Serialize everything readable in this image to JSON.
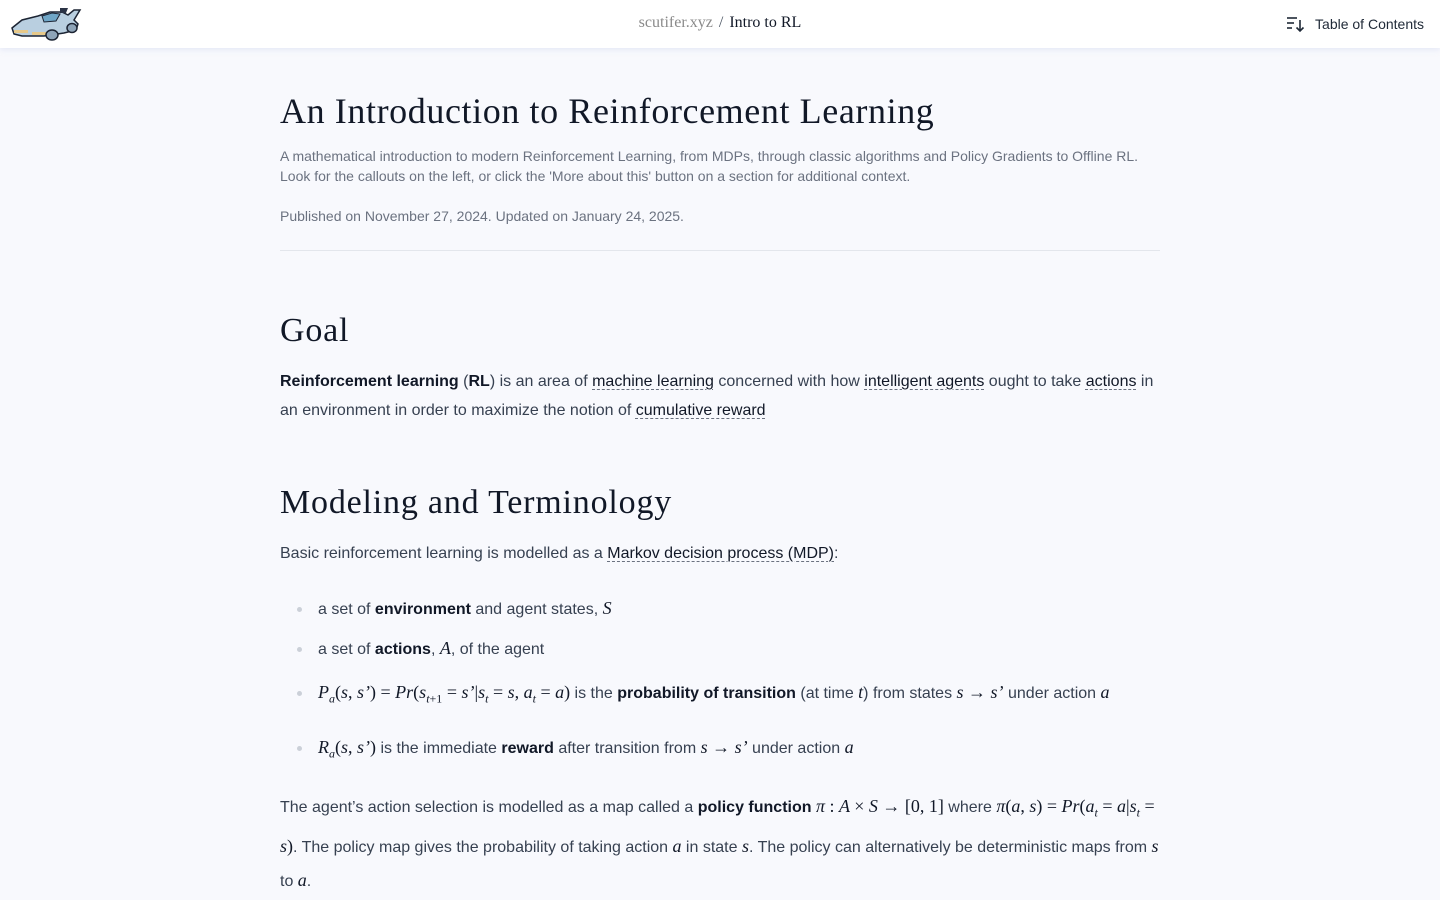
{
  "header": {
    "logo_alt": "hover car logo",
    "breadcrumb": {
      "site": "scutifer.xyz",
      "separator": "/",
      "page": "Intro to RL"
    },
    "toc_label": "Table of Contents",
    "toc_icon": "sort-list-icon"
  },
  "article": {
    "title": "An Introduction to Reinforcement Learning",
    "subtitle_line1": "A mathematical introduction to modern Reinforcement Learning, from MDPs, through classic algorithms and Policy Gradients to Offline RL.",
    "subtitle_line2": "Look for the callouts on the left, or click the 'More about this' button on a section for additional context.",
    "published": "Published on November 27, 2024. Updated on January 24, 2025."
  },
  "goal": {
    "heading": "Goal",
    "rl_bold": "Reinforcement learning",
    "rl_abbr_open": " (",
    "rl_abbr": "RL",
    "text1": ") is an area of ",
    "link_ml": "machine learning",
    "text2": " concerned with how ",
    "link_agents": "intelligent agents",
    "text3": " ought to take ",
    "link_actions": "actions",
    "text4": " in an environment in order to maximize the notion of ",
    "link_reward": "cumulative reward"
  },
  "modeling": {
    "heading": "Modeling and Terminology",
    "intro": "Basic reinforcement learning is modelled as a ",
    "link_mdp": "Markov decision process (MDP)",
    "intro_end": ":",
    "items": [
      {
        "pre": "a set of ",
        "bold": "environment",
        "post": " and agent states, ",
        "math": "S"
      },
      {
        "pre": "a set of ",
        "bold": "actions",
        "post1": ", ",
        "math": "A",
        "post2": ", of the agent"
      },
      {
        "text1": " is the ",
        "bold": "probability of transition",
        "text2": " (at time ",
        "math_t": "t",
        "text3": ") from states ",
        "text4": " under action ",
        "math_a": "a"
      },
      {
        "text1": " is the immediate ",
        "bold": "reward",
        "text2": " after transition from ",
        "text3": " under action ",
        "math_a": "a"
      }
    ],
    "policy": {
      "text1": "The agent’s action selection is modelled as a map called a ",
      "bold": "policy function",
      "text2": " where ",
      "text3": ". The policy map gives the probability of taking action ",
      "math_a": "a",
      "text4": " in state ",
      "math_s": "s",
      "text5": ". The policy can alternatively be deterministic maps from ",
      "text6": " to ",
      "end": "."
    }
  }
}
